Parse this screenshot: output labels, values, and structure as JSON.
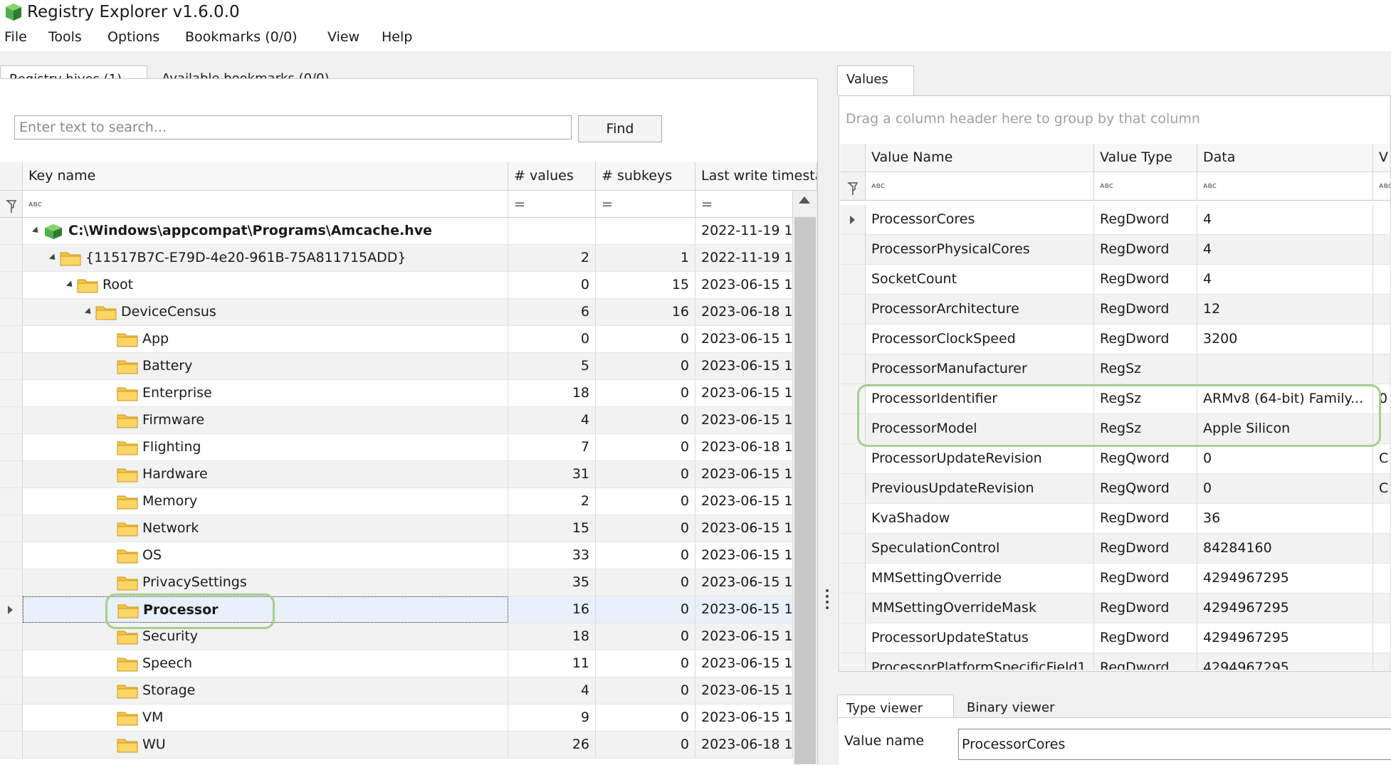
{
  "app": {
    "title": "Registry Explorer v1.6.0.0"
  },
  "menu": {
    "items": [
      "File",
      "Tools",
      "Options",
      "Bookmarks (0/0)",
      "View",
      "Help"
    ]
  },
  "left_tabs": [
    "Registry hives (1)",
    "Available bookmarks (0/0)"
  ],
  "search": {
    "placeholder": "Enter text to search...",
    "value": "",
    "button": "Find"
  },
  "tree": {
    "columns": [
      "Key name",
      "# values",
      "# subkeys",
      "Last write timesta"
    ],
    "filter_glyph": "ᴀʙc",
    "filter_eq": "=",
    "rows": [
      {
        "name": "C:\\Windows\\appcompat\\Programs\\Amcache.hve",
        "values": "",
        "subkeys": "",
        "ts": "2022-11-19 1",
        "level": 0,
        "type": "hive",
        "bold": true
      },
      {
        "name": "{11517B7C-E79D-4e20-961B-75A811715ADD}",
        "values": "2",
        "subkeys": "1",
        "ts": "2022-11-19 1",
        "level": 1,
        "type": "folder"
      },
      {
        "name": "Root",
        "values": "0",
        "subkeys": "15",
        "ts": "2023-06-15 1",
        "level": 2,
        "type": "folder"
      },
      {
        "name": "DeviceCensus",
        "values": "6",
        "subkeys": "16",
        "ts": "2023-06-18 1",
        "level": 3,
        "type": "folder"
      },
      {
        "name": "App",
        "values": "0",
        "subkeys": "0",
        "ts": "2023-06-15 1",
        "level": 4,
        "type": "folder"
      },
      {
        "name": "Battery",
        "values": "5",
        "subkeys": "0",
        "ts": "2023-06-15 1",
        "level": 4,
        "type": "folder"
      },
      {
        "name": "Enterprise",
        "values": "18",
        "subkeys": "0",
        "ts": "2023-06-15 1",
        "level": 4,
        "type": "folder"
      },
      {
        "name": "Firmware",
        "values": "4",
        "subkeys": "0",
        "ts": "2023-06-15 1",
        "level": 4,
        "type": "folder"
      },
      {
        "name": "Flighting",
        "values": "7",
        "subkeys": "0",
        "ts": "2023-06-18 1",
        "level": 4,
        "type": "folder"
      },
      {
        "name": "Hardware",
        "values": "31",
        "subkeys": "0",
        "ts": "2023-06-15 1",
        "level": 4,
        "type": "folder"
      },
      {
        "name": "Memory",
        "values": "2",
        "subkeys": "0",
        "ts": "2023-06-15 1",
        "level": 4,
        "type": "folder"
      },
      {
        "name": "Network",
        "values": "15",
        "subkeys": "0",
        "ts": "2023-06-15 1",
        "level": 4,
        "type": "folder"
      },
      {
        "name": "OS",
        "values": "33",
        "subkeys": "0",
        "ts": "2023-06-15 1",
        "level": 4,
        "type": "folder"
      },
      {
        "name": "PrivacySettings",
        "values": "35",
        "subkeys": "0",
        "ts": "2023-06-15 1",
        "level": 4,
        "type": "folder"
      },
      {
        "name": "Processor",
        "values": "16",
        "subkeys": "0",
        "ts": "2023-06-15 1",
        "level": 4,
        "type": "folder",
        "bold": true,
        "selected": true
      },
      {
        "name": "Security",
        "values": "18",
        "subkeys": "0",
        "ts": "2023-06-15 1",
        "level": 4,
        "type": "folder"
      },
      {
        "name": "Speech",
        "values": "11",
        "subkeys": "0",
        "ts": "2023-06-15 1",
        "level": 4,
        "type": "folder"
      },
      {
        "name": "Storage",
        "values": "4",
        "subkeys": "0",
        "ts": "2023-06-15 1",
        "level": 4,
        "type": "folder"
      },
      {
        "name": "VM",
        "values": "9",
        "subkeys": "0",
        "ts": "2023-06-15 1",
        "level": 4,
        "type": "folder"
      },
      {
        "name": "WU",
        "values": "26",
        "subkeys": "0",
        "ts": "2023-06-18 1",
        "level": 4,
        "type": "folder"
      }
    ]
  },
  "right_tab": "Values",
  "values_grid": {
    "group_hint": "Drag a column header here to group by that column",
    "columns": [
      "Value Name",
      "Value Type",
      "Data",
      "V"
    ],
    "rows": [
      {
        "name": "ProcessorCores",
        "type": "RegDword",
        "data": "4",
        "extra": ""
      },
      {
        "name": "ProcessorPhysicalCores",
        "type": "RegDword",
        "data": "4",
        "extra": ""
      },
      {
        "name": "SocketCount",
        "type": "RegDword",
        "data": "4",
        "extra": ""
      },
      {
        "name": "ProcessorArchitecture",
        "type": "RegDword",
        "data": "12",
        "extra": ""
      },
      {
        "name": "ProcessorClockSpeed",
        "type": "RegDword",
        "data": "3200",
        "extra": ""
      },
      {
        "name": "ProcessorManufacturer",
        "type": "RegSz",
        "data": "",
        "extra": ""
      },
      {
        "name": "ProcessorIdentifier",
        "type": "RegSz",
        "data": "ARMv8 (64-bit) Family...",
        "extra": "0"
      },
      {
        "name": "ProcessorModel",
        "type": "RegSz",
        "data": "Apple Silicon",
        "extra": ""
      },
      {
        "name": "ProcessorUpdateRevision",
        "type": "RegQword",
        "data": "0",
        "extra": "C"
      },
      {
        "name": "PreviousUpdateRevision",
        "type": "RegQword",
        "data": "0",
        "extra": "C"
      },
      {
        "name": "KvaShadow",
        "type": "RegDword",
        "data": "36",
        "extra": ""
      },
      {
        "name": "SpeculationControl",
        "type": "RegDword",
        "data": "84284160",
        "extra": ""
      },
      {
        "name": "MMSettingOverride",
        "type": "RegDword",
        "data": "4294967295",
        "extra": ""
      },
      {
        "name": "MMSettingOverrideMask",
        "type": "RegDword",
        "data": "4294967295",
        "extra": ""
      },
      {
        "name": "ProcessorUpdateStatus",
        "type": "RegDword",
        "data": "4294967295",
        "extra": ""
      },
      {
        "name": "ProcessorPlatformSpecificField1",
        "type": "RegDword",
        "data": "4294967295",
        "extra": ""
      }
    ]
  },
  "viewer_tabs": [
    "Type viewer",
    "Binary viewer"
  ],
  "value_name": {
    "label": "Value name",
    "value": "ProcessorCores"
  },
  "colors": {
    "highlight": "#a6cf8c",
    "selection": "#e8f0fa",
    "folder": "#f5c542"
  }
}
